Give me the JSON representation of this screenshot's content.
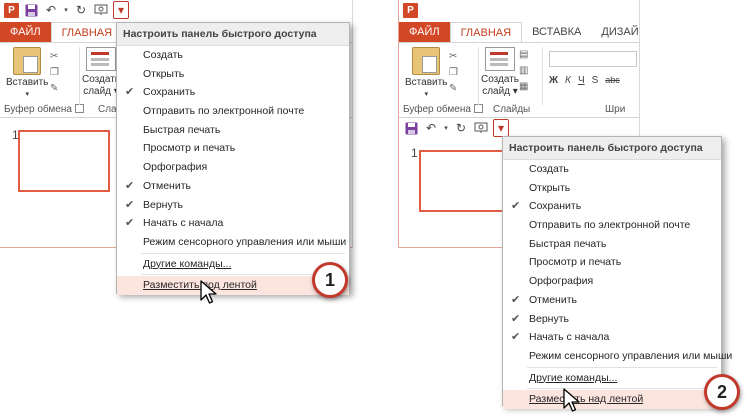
{
  "app": {
    "logo_letter": "P",
    "brand_color": "#d24726",
    "accent_color": "#c0392b"
  },
  "qat": {
    "icons": [
      "powerpoint-logo-icon",
      "save-icon",
      "undo-icon",
      "redo-icon",
      "slideshow-icon",
      "customize-qat-dropdown-icon"
    ]
  },
  "left": {
    "tabs": [
      "ФАЙЛ",
      "ГЛАВНАЯ"
    ],
    "groups": {
      "clipboard": "Буфер обмена",
      "slides_partial": "Слай"
    },
    "buttons": {
      "paste": "Вставить",
      "new_slide_line1": "Создать",
      "new_slide_line2": "слайд"
    },
    "slide_number": "1"
  },
  "right": {
    "tabs": [
      "ФАЙЛ",
      "ГЛАВНАЯ",
      "ВСТАВКА",
      "ДИЗАЙН"
    ],
    "groups": {
      "clipboard": "Буфер обмена",
      "slides": "Слайды",
      "font_partial": "Шри"
    },
    "buttons": {
      "paste": "Вставить",
      "new_slide_line1": "Создать",
      "new_slide_line2": "слайд"
    },
    "font_buttons": [
      "Ж",
      "К",
      "Ч",
      "S",
      "abc"
    ],
    "slide_number": "1"
  },
  "menu": {
    "title": "Настроить панель быстрого доступа",
    "items": [
      {
        "label": "Создать",
        "checked": false
      },
      {
        "label": "Открыть",
        "checked": false
      },
      {
        "label": "Сохранить",
        "checked": true
      },
      {
        "label": "Отправить по электронной почте",
        "checked": false
      },
      {
        "label": "Быстрая печать",
        "checked": false
      },
      {
        "label": "Просмотр и печать",
        "checked": false
      },
      {
        "label": "Орфография",
        "checked": false
      },
      {
        "label": "Отменить",
        "checked": true
      },
      {
        "label": "Вернуть",
        "checked": true
      },
      {
        "label": "Начать с начала",
        "checked": true
      },
      {
        "label": "Режим сенсорного управления или мыши",
        "checked": false
      }
    ],
    "more_commands": "Другие команды...",
    "show_below": "Разместить под лентой",
    "show_above": "Разместить над лентой",
    "check_mark": "✔"
  },
  "badges": {
    "one": "1",
    "two": "2"
  }
}
